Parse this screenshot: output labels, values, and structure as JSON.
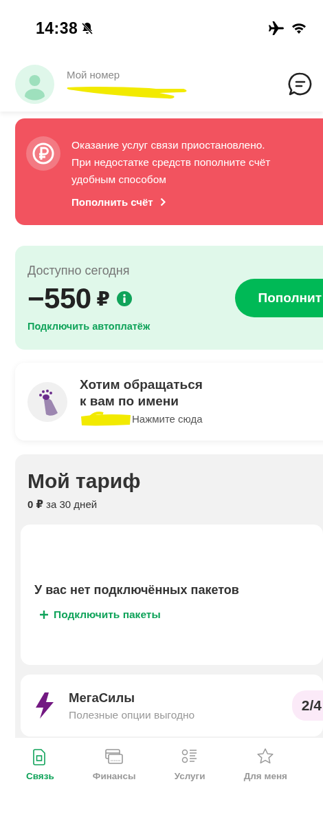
{
  "status_bar": {
    "time": "14:38",
    "silent": true
  },
  "header": {
    "label": "Мой номер"
  },
  "alert": {
    "text": "Оказание услуг связи приостановлено. При недостатке средств пополните счёт удобным способом",
    "link": "Пополнить счёт"
  },
  "balance": {
    "label": "Доступно сегодня",
    "amount": "−550",
    "currency": "₽",
    "autopay": "Подключить автоплатёж",
    "button": "Пополнит"
  },
  "name_card": {
    "title": "Хотим обращаться к вам по имени",
    "hint": "Нажмите сюда"
  },
  "tariff": {
    "title": "Мой тариф",
    "price": "**0 ₽** за 30 дней",
    "empty_text": "У вас нет подключённых пакетов",
    "add_link": "Подключить пакеты"
  },
  "megasily": {
    "title": "МегаСилы",
    "subtitle": "Полезные опции выгодно",
    "count": "2/4"
  },
  "tabs": [
    {
      "label": "Связь",
      "kind": "sim",
      "selected": true
    },
    {
      "label": "Финансы",
      "kind": "cards",
      "selected": false
    },
    {
      "label": "Услуги",
      "kind": "list",
      "selected": false
    },
    {
      "label": "Для меня",
      "kind": "star",
      "selected": false
    }
  ]
}
